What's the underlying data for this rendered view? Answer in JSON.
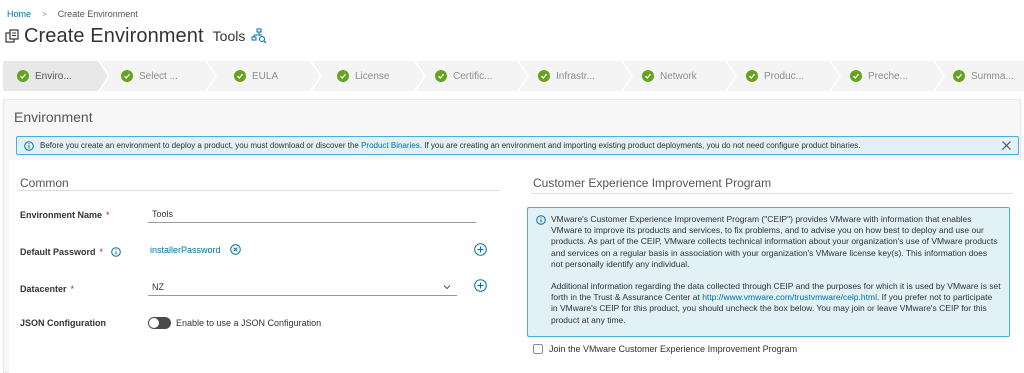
{
  "breadcrumb": {
    "home": "Home",
    "current": "Create Environment"
  },
  "header": {
    "title": "Create Environment",
    "subtitle": "Tools"
  },
  "steps": [
    {
      "label": "Enviro...",
      "state": "active"
    },
    {
      "label": "Select ...",
      "state": "done"
    },
    {
      "label": "EULA",
      "state": "done"
    },
    {
      "label": "License",
      "state": "done"
    },
    {
      "label": "Certific...",
      "state": "done"
    },
    {
      "label": "Infrastr...",
      "state": "done"
    },
    {
      "label": "Network",
      "state": "done"
    },
    {
      "label": "Produc...",
      "state": "done"
    },
    {
      "label": "Preche...",
      "state": "done"
    },
    {
      "label": "Summa...",
      "state": "done"
    }
  ],
  "panel": {
    "title": "Environment"
  },
  "alert": {
    "text_before": "Before you create an environment to deploy a product, you must download or discover the ",
    "link": "Product Binaries",
    "text_after": ". If you are creating an environment and importing existing product deployments, you do not need configure product binaries."
  },
  "common": {
    "title": "Common",
    "env_name_label": "Environment Name",
    "env_name_value": "Tools",
    "password_label": "Default Password",
    "password_value": "installerPassword",
    "datacenter_label": "Datacenter",
    "datacenter_value": "NZ",
    "json_label": "JSON Configuration",
    "json_toggle_text": "Enable to use a JSON Configuration",
    "required_mark": "*"
  },
  "ceip": {
    "title": "Customer Experience Improvement Program",
    "para1": "VMware's Customer Experience Improvement Program (\"CEIP\") provides VMware with information that enables VMware to improve its products and services, to fix problems, and to advise you on how best to deploy and use our products. As part of the CEIP, VMware collects technical information about your organization's use of VMware products and services on a regular basis in association with your organization's VMware license key(s). This information does not personally identify any individual.",
    "para2_before": "Additional information regarding the data collected through CEIP and the purposes for which it is used by VMware is set forth in the Trust & Assurance Center at ",
    "para2_link": "http://www.vmware.com/trustvmware/ceip.html",
    "para2_after": ". If you prefer not to participate in VMware's CEIP for this product, you should uncheck the box below. You may join or leave VMware's CEIP for this product at any time.",
    "checkbox_label": "Join the VMware Customer Experience Improvement Program",
    "checkbox_checked": false
  },
  "colors": {
    "accent": "#0072a3",
    "success": "#62a420",
    "info_bg": "#e1f1f6",
    "info_border": "#49afd9"
  }
}
